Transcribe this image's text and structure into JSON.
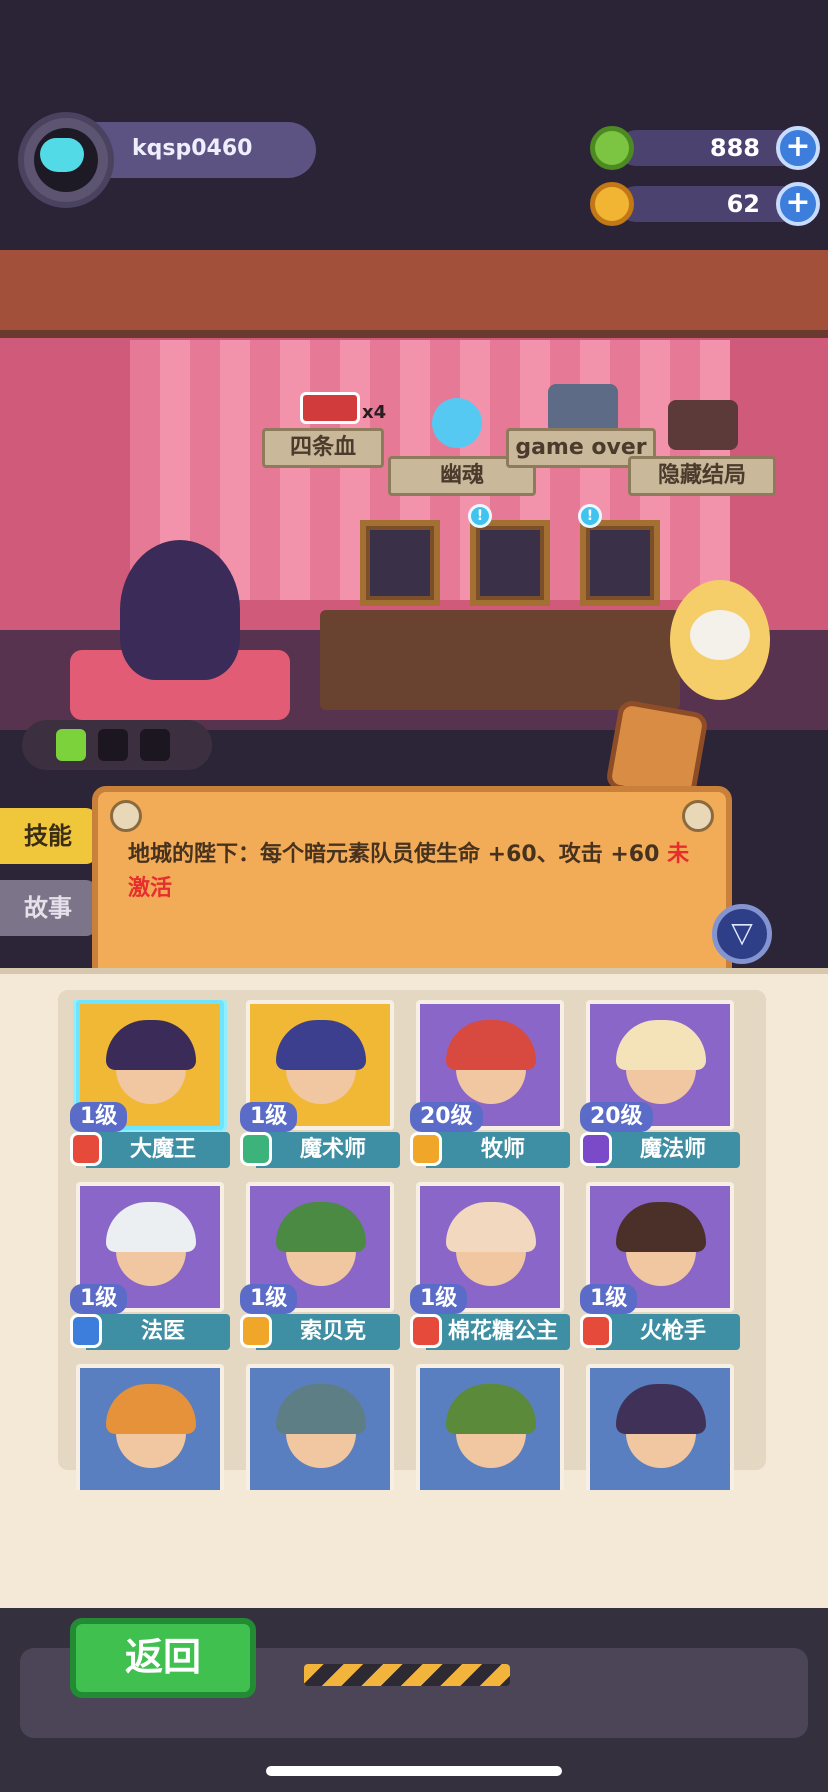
{
  "player": {
    "name": "kqsp0460"
  },
  "currency": {
    "gems": {
      "value": "888",
      "icon": "green-gem-icon"
    },
    "gold": {
      "value": "62",
      "icon": "gold-planet-icon"
    },
    "plus_label": "+"
  },
  "scene": {
    "signs": {
      "four_hp": "四条血",
      "ghost": "幽魂",
      "game_over": "game over",
      "hidden_ending": "隐藏结局"
    },
    "hp_badge": "x4",
    "pin_label": "!"
  },
  "side_tabs": {
    "skill": "技能",
    "story": "故事"
  },
  "skill": {
    "text": "地城的陛下：每个暗元素队员使生命 +60、攻击 +60",
    "status": "未激活"
  },
  "characters": [
    {
      "level": "1级",
      "name": "大魔王",
      "element_color": "#e64a3b",
      "hair_color": "#3a2b58",
      "bg": "#f1b836",
      "selected": true
    },
    {
      "level": "1级",
      "name": "魔术师",
      "element_color": "#3bb37a",
      "hair_color": "#3b3f8e",
      "bg": "#f1b836",
      "selected": false
    },
    {
      "level": "20级",
      "name": "牧师",
      "element_color": "#f0a628",
      "hair_color": "#d84a3f",
      "bg": "#8a66c9",
      "selected": false
    },
    {
      "level": "20级",
      "name": "魔法师",
      "element_color": "#7a4ac8",
      "hair_color": "#f4e2b8",
      "bg": "#8a66c9",
      "selected": false
    },
    {
      "level": "1级",
      "name": "法医",
      "element_color": "#3d7ddb",
      "hair_color": "#eceff2",
      "bg": "#8a66c9",
      "selected": false
    },
    {
      "level": "1级",
      "name": "索贝克",
      "element_color": "#f0a628",
      "hair_color": "#4a8a42",
      "bg": "#8a66c9",
      "selected": false
    },
    {
      "level": "1级",
      "name": "棉花糖公主",
      "element_color": "#e64a3b",
      "hair_color": "#f3d8c0",
      "bg": "#8a66c9",
      "selected": false
    },
    {
      "level": "1级",
      "name": "火枪手",
      "element_color": "#e64a3b",
      "hair_color": "#4a3029",
      "bg": "#8a66c9",
      "selected": false
    },
    {
      "level": "",
      "name": "",
      "element_color": "#3d7ddb",
      "hair_color": "#e6923b",
      "bg": "#5a7fc0",
      "selected": false
    },
    {
      "level": "",
      "name": "",
      "element_color": "#3d7ddb",
      "hair_color": "#5e7e86",
      "bg": "#5a7fc0",
      "selected": false
    },
    {
      "level": "",
      "name": "",
      "element_color": "#3d7ddb",
      "hair_color": "#5a8a3a",
      "bg": "#5a7fc0",
      "selected": false
    },
    {
      "level": "",
      "name": "",
      "element_color": "#3d7ddb",
      "hair_color": "#3f3158",
      "bg": "#5a7fc0",
      "selected": false
    }
  ],
  "footer": {
    "back_label": "返回"
  },
  "colors": {
    "accent_cyan": "#52dbe6",
    "skill_panel": "#f2ac57",
    "inactive_red": "#e72d2d",
    "back_green": "#3fc04f"
  }
}
